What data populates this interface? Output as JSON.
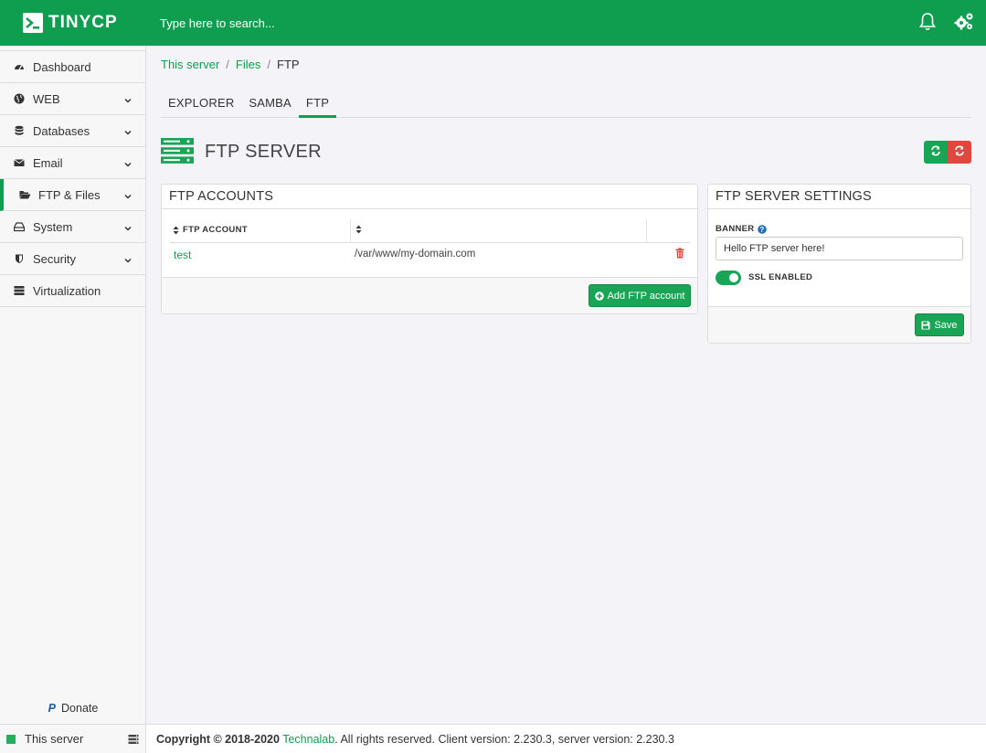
{
  "app": {
    "brand": "TINYCP",
    "search_placeholder": "Type here to search..."
  },
  "sidebar": {
    "items": [
      {
        "label": "Dashboard",
        "icon": "dashboard-icon"
      },
      {
        "label": "WEB",
        "icon": "globe-icon"
      },
      {
        "label": "Databases",
        "icon": "database-icon"
      },
      {
        "label": "Email",
        "icon": "envelope-icon"
      },
      {
        "label": "FTP & Files",
        "icon": "folder-icon"
      },
      {
        "label": "System",
        "icon": "hdd-icon"
      },
      {
        "label": "Security",
        "icon": "shield-icon"
      },
      {
        "label": "Virtualization",
        "icon": "server-icon"
      }
    ],
    "active_item": "FTP & Files",
    "donate_label": "Donate",
    "server_label": "This server"
  },
  "breadcrumb": {
    "items": [
      "This server",
      "Files",
      "FTP"
    ]
  },
  "tabs": [
    {
      "label": "EXPLORER"
    },
    {
      "label": "SAMBA"
    },
    {
      "label": "FTP"
    }
  ],
  "active_tab": "FTP",
  "page": {
    "title": "FTP SERVER"
  },
  "accounts_panel": {
    "title": "FTP ACCOUNTS",
    "columns": [
      "FTP ACCOUNT",
      ""
    ],
    "rows": [
      {
        "account": "test",
        "path": "/var/www/my-domain.com"
      }
    ],
    "add_button_label": "Add FTP account"
  },
  "settings_panel": {
    "title": "FTP SERVER SETTINGS",
    "banner_label": "BANNER",
    "banner_value": "Hello FTP server here!",
    "ssl_label": "SSL ENABLED",
    "ssl_enabled": true,
    "save_label": "Save"
  },
  "footer": {
    "copyright": "Copyright © 2018-2020",
    "company": "Technalab",
    "rest": ". All rights reserved. Client version: 2.230.3, server version: 2.230.3"
  },
  "colors": {
    "brand_green": "#0f9d4f",
    "button_green": "#1aa556",
    "button_red": "#e0483d",
    "delete_red": "#e0483d"
  }
}
